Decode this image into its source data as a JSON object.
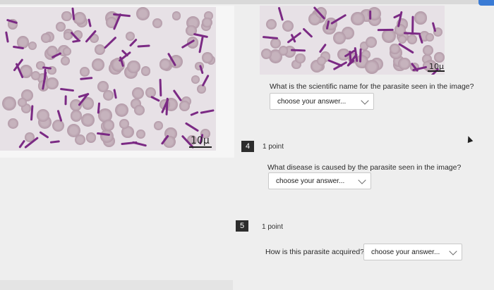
{
  "image_left": {
    "scale_label": "10μ"
  },
  "image_right": {
    "scale_label": "10μ"
  },
  "questions": [
    {
      "text": "What is the scientific name for the parasite seen in the image?",
      "dropdown": "choose your answer..."
    },
    {
      "number": "4",
      "points": "1 point",
      "text": "What disease is caused by the parasite seen in the image?",
      "dropdown": "choose your answer..."
    },
    {
      "number": "5",
      "points": "1 point",
      "text": "How is this parasite acquired?",
      "dropdown": "choose your answer..."
    }
  ],
  "icons": [
    "chevron-down-icon",
    "mouse-cursor-icon"
  ],
  "colors": {
    "rbc": "#c6b3bd",
    "parasite": "#7b2a84",
    "question_number_bg": "#2d2d2d",
    "accent": "#3a7bd5"
  }
}
